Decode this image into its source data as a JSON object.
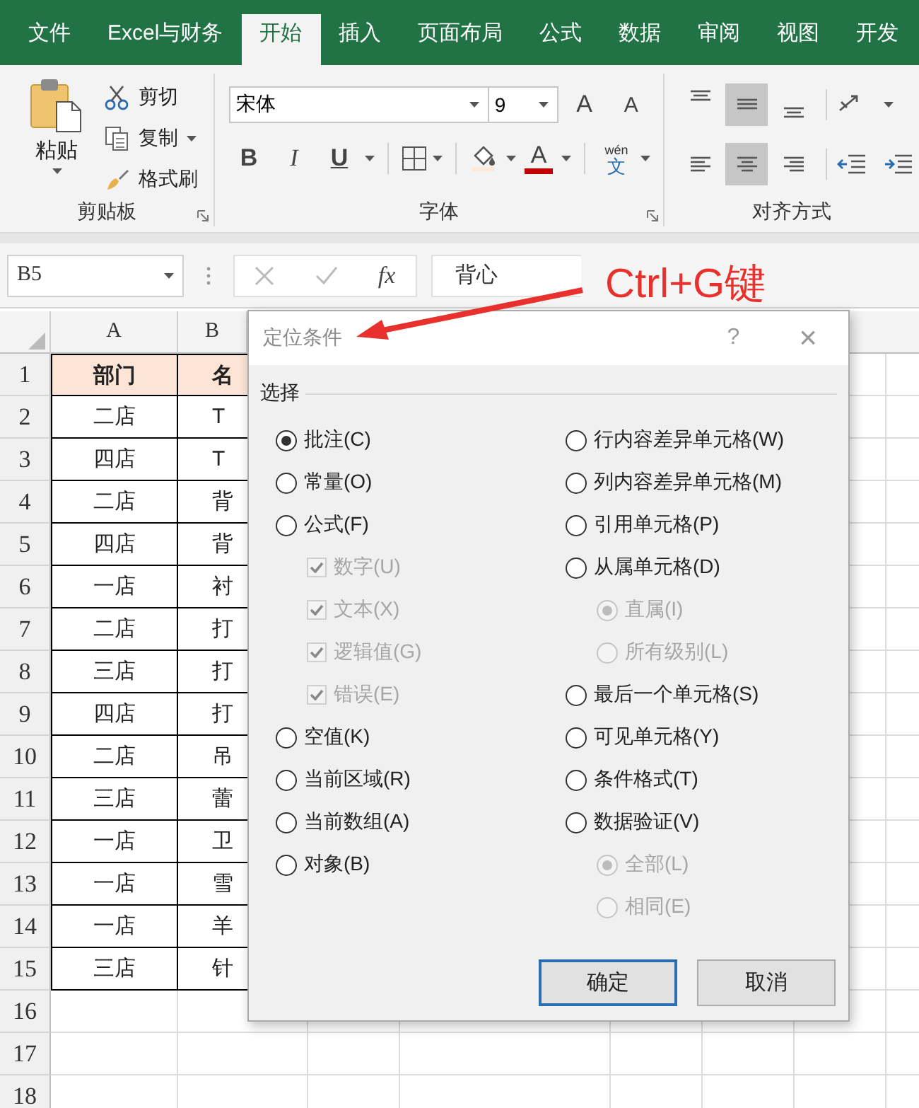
{
  "ribbon": {
    "tabs": [
      {
        "label": "文件",
        "selected": false
      },
      {
        "label": "Excel与财务",
        "selected": false
      },
      {
        "label": "开始",
        "selected": true
      },
      {
        "label": "插入",
        "selected": false
      },
      {
        "label": "页面布局",
        "selected": false
      },
      {
        "label": "公式",
        "selected": false
      },
      {
        "label": "数据",
        "selected": false
      },
      {
        "label": "审阅",
        "selected": false
      },
      {
        "label": "视图",
        "selected": false
      },
      {
        "label": "开发",
        "selected": false
      }
    ],
    "clipboard": {
      "label": "剪贴板",
      "paste": "粘贴",
      "cut": "剪切",
      "copy": "复制",
      "format_painter": "格式刷"
    },
    "font": {
      "label": "字体",
      "name": "宋体",
      "size": "9",
      "grow": "A",
      "shrink": "A",
      "bold": "B",
      "italic": "I",
      "underline": "U",
      "font_color": "A",
      "phonetic_top": "wén",
      "phonetic_bottom": "文"
    },
    "alignment": {
      "label": "对齐方式",
      "vertical": [
        {
          "kind": "top",
          "selected": false
        },
        {
          "kind": "middle",
          "selected": true
        },
        {
          "kind": "bottom",
          "selected": false
        }
      ],
      "horizontal": [
        {
          "kind": "left",
          "selected": false
        },
        {
          "kind": "center",
          "selected": true
        },
        {
          "kind": "right",
          "selected": false
        }
      ]
    }
  },
  "formula_bar": {
    "name_box": "B5",
    "function": "fx",
    "value": "背心"
  },
  "sheet": {
    "columns": [
      "A",
      "B"
    ],
    "header_row": {
      "row": "1",
      "cells": [
        "部门",
        "名"
      ]
    },
    "rows": [
      {
        "row": "2",
        "cells": [
          "二店",
          "T"
        ]
      },
      {
        "row": "3",
        "cells": [
          "四店",
          "T"
        ]
      },
      {
        "row": "4",
        "cells": [
          "二店",
          "背"
        ]
      },
      {
        "row": "5",
        "cells": [
          "四店",
          "背"
        ]
      },
      {
        "row": "6",
        "cells": [
          "一店",
          "衬"
        ]
      },
      {
        "row": "7",
        "cells": [
          "二店",
          "打"
        ]
      },
      {
        "row": "8",
        "cells": [
          "三店",
          "打"
        ]
      },
      {
        "row": "9",
        "cells": [
          "四店",
          "打"
        ]
      },
      {
        "row": "10",
        "cells": [
          "二店",
          "吊"
        ]
      },
      {
        "row": "11",
        "cells": [
          "三店",
          "蕾"
        ]
      },
      {
        "row": "12",
        "cells": [
          "一店",
          "卫"
        ]
      },
      {
        "row": "13",
        "cells": [
          "一店",
          "雪"
        ]
      },
      {
        "row": "14",
        "cells": [
          "一店",
          "羊"
        ]
      },
      {
        "row": "15",
        "cells": [
          "三店",
          "针"
        ]
      }
    ],
    "empty_rows": [
      "16",
      "17",
      "18"
    ]
  },
  "dialog": {
    "title": "定位条件",
    "help": "?",
    "close": "×",
    "section": "选择",
    "left": [
      {
        "kind": "radio",
        "label": "批注(C)",
        "selected": true,
        "disabled": false
      },
      {
        "kind": "radio",
        "label": "常量(O)",
        "selected": false,
        "disabled": false
      },
      {
        "kind": "radio",
        "label": "公式(F)",
        "selected": false,
        "disabled": false,
        "children": [
          {
            "kind": "checkbox",
            "label": "数字(U)",
            "checked": true,
            "disabled": true
          },
          {
            "kind": "checkbox",
            "label": "文本(X)",
            "checked": true,
            "disabled": true
          },
          {
            "kind": "checkbox",
            "label": "逻辑值(G)",
            "checked": true,
            "disabled": true
          },
          {
            "kind": "checkbox",
            "label": "错误(E)",
            "checked": true,
            "disabled": true
          }
        ]
      },
      {
        "kind": "radio",
        "label": "空值(K)",
        "selected": false,
        "disabled": false
      },
      {
        "kind": "radio",
        "label": "当前区域(R)",
        "selected": false,
        "disabled": false
      },
      {
        "kind": "radio",
        "label": "当前数组(A)",
        "selected": false,
        "disabled": false
      },
      {
        "kind": "radio",
        "label": "对象(B)",
        "selected": false,
        "disabled": false
      }
    ],
    "right": [
      {
        "kind": "radio",
        "label": "行内容差异单元格(W)",
        "selected": false,
        "disabled": false
      },
      {
        "kind": "radio",
        "label": "列内容差异单元格(M)",
        "selected": false,
        "disabled": false
      },
      {
        "kind": "radio",
        "label": "引用单元格(P)",
        "selected": false,
        "disabled": false
      },
      {
        "kind": "radio",
        "label": "从属单元格(D)",
        "selected": false,
        "disabled": false,
        "children": [
          {
            "kind": "radio",
            "label": "直属(I)",
            "selected": true,
            "disabled": true
          },
          {
            "kind": "radio",
            "label": "所有级别(L)",
            "selected": false,
            "disabled": true
          }
        ]
      },
      {
        "kind": "radio",
        "label": "最后一个单元格(S)",
        "selected": false,
        "disabled": false
      },
      {
        "kind": "radio",
        "label": "可见单元格(Y)",
        "selected": false,
        "disabled": false
      },
      {
        "kind": "radio",
        "label": "条件格式(T)",
        "selected": false,
        "disabled": false
      },
      {
        "kind": "radio",
        "label": "数据验证(V)",
        "selected": false,
        "disabled": false,
        "children": [
          {
            "kind": "radio",
            "label": "全部(L)",
            "selected": true,
            "disabled": true
          },
          {
            "kind": "radio",
            "label": "相同(E)",
            "selected": false,
            "disabled": true
          }
        ]
      }
    ],
    "buttons": [
      {
        "label": "确定",
        "default": true
      },
      {
        "label": "取消",
        "default": false
      }
    ]
  },
  "annotation": {
    "text": "Ctrl+G键"
  }
}
